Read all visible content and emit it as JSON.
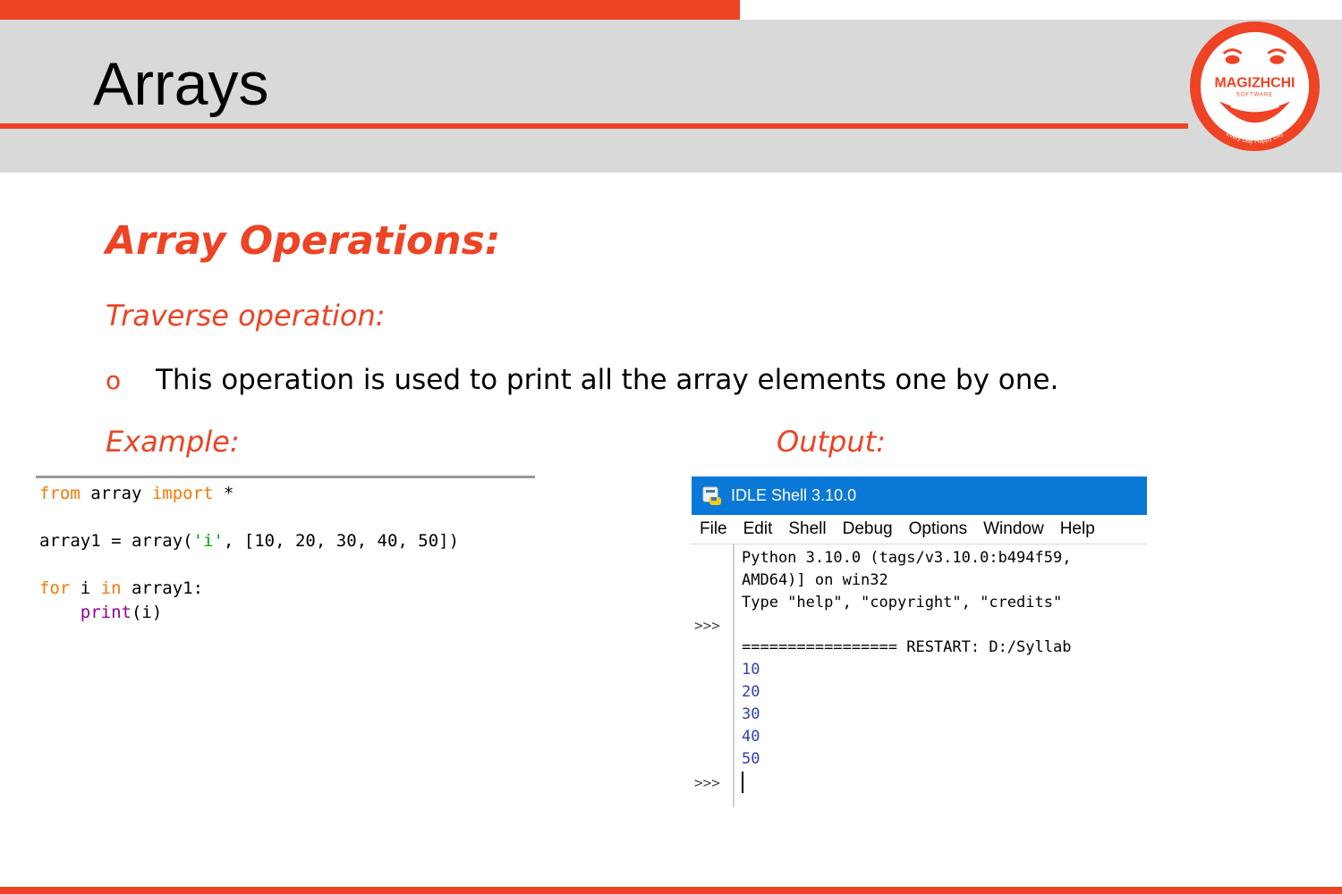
{
  "header": {
    "title": "Arrays",
    "logo": {
      "brand": "MAGIZHCHI",
      "subbrand": "SOFTWARE",
      "tagline": "Every Day Happy Day",
      "icon": "smiling-face-logo-icon"
    }
  },
  "content": {
    "section_title": "Array Operations:",
    "traverse_label": "Traverse operation:",
    "bullet_mark": "o",
    "bullet_text": "This operation is used to print all the array elements one by one.",
    "example_label": "Example:",
    "output_label": "Output:"
  },
  "code": {
    "line1": {
      "kw1": "from",
      "mid": " array ",
      "kw2": "import",
      "rest": " *"
    },
    "line2": {
      "pre": "array1 = array(",
      "str": "'i'",
      "post": ", [10, 20, 30, 40, 50])"
    },
    "line3": {
      "kw1": "for",
      "mid1": " i ",
      "kw2": "in",
      "mid2": " array1:"
    },
    "line4": {
      "indent": "    ",
      "fn": "print",
      "post": "(i)"
    }
  },
  "idle": {
    "window_title": "IDLE Shell 3.10.0",
    "menu": [
      "File",
      "Edit",
      "Shell",
      "Debug",
      "Options",
      "Window",
      "Help"
    ],
    "prompt": ">>>",
    "banner": [
      "Python 3.10.0 (tags/v3.10.0:b494f59,",
      "AMD64)] on win32",
      "Type \"help\", \"copyright\", \"credits\""
    ],
    "restart_line": "================= RESTART: D:/Syllab",
    "outputs": [
      "10",
      "20",
      "30",
      "40",
      "50"
    ]
  },
  "colors": {
    "accent": "#ee4324",
    "header_band": "#d9d9d9",
    "idle_titlebar": "#0a78d7",
    "code_keyword": "#ff7700",
    "code_string": "#00aa00",
    "code_builtin": "#900090",
    "shell_output": "#2f3fb0"
  }
}
